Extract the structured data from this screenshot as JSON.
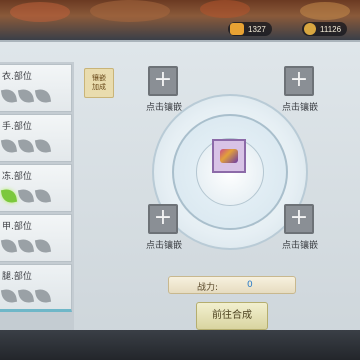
{
  "currencies": [
    {
      "icon": "gold-ingot-icon",
      "value": "1327",
      "color": "#e9a233"
    },
    {
      "icon": "gem-coin-icon",
      "value": "11126",
      "color": "#d8a640"
    }
  ],
  "slot_list": [
    {
      "label": "衣.部位",
      "leaves": [
        "gray",
        "gray",
        "gray"
      ]
    },
    {
      "label": "手.部位",
      "leaves": [
        "gray",
        "gray",
        "gray"
      ]
    },
    {
      "label": "冻.部位",
      "leaves": [
        "green",
        "gray",
        "gray"
      ]
    },
    {
      "label": "甲.部位",
      "leaves": [
        "gray",
        "gray",
        "gray"
      ]
    },
    {
      "label": "腿.部位",
      "leaves": [
        "gray",
        "gray",
        "gray"
      ]
    }
  ],
  "side_tab": {
    "line1": "镶嵌",
    "line2": "加成"
  },
  "add_slots": [
    {
      "caption": "点击镶嵌",
      "symbol": "+"
    },
    {
      "caption": "点击镶嵌",
      "symbol": "+"
    },
    {
      "caption": "点击镶嵌",
      "symbol": "+"
    },
    {
      "caption": "点击镶嵌",
      "symbol": "+"
    }
  ],
  "power": {
    "label": "战力:",
    "value": "0"
  },
  "go_button": {
    "label": "前往合成"
  },
  "colors": {
    "leaf_active": "#7cc83c",
    "power_value": "#2a7cc8"
  }
}
